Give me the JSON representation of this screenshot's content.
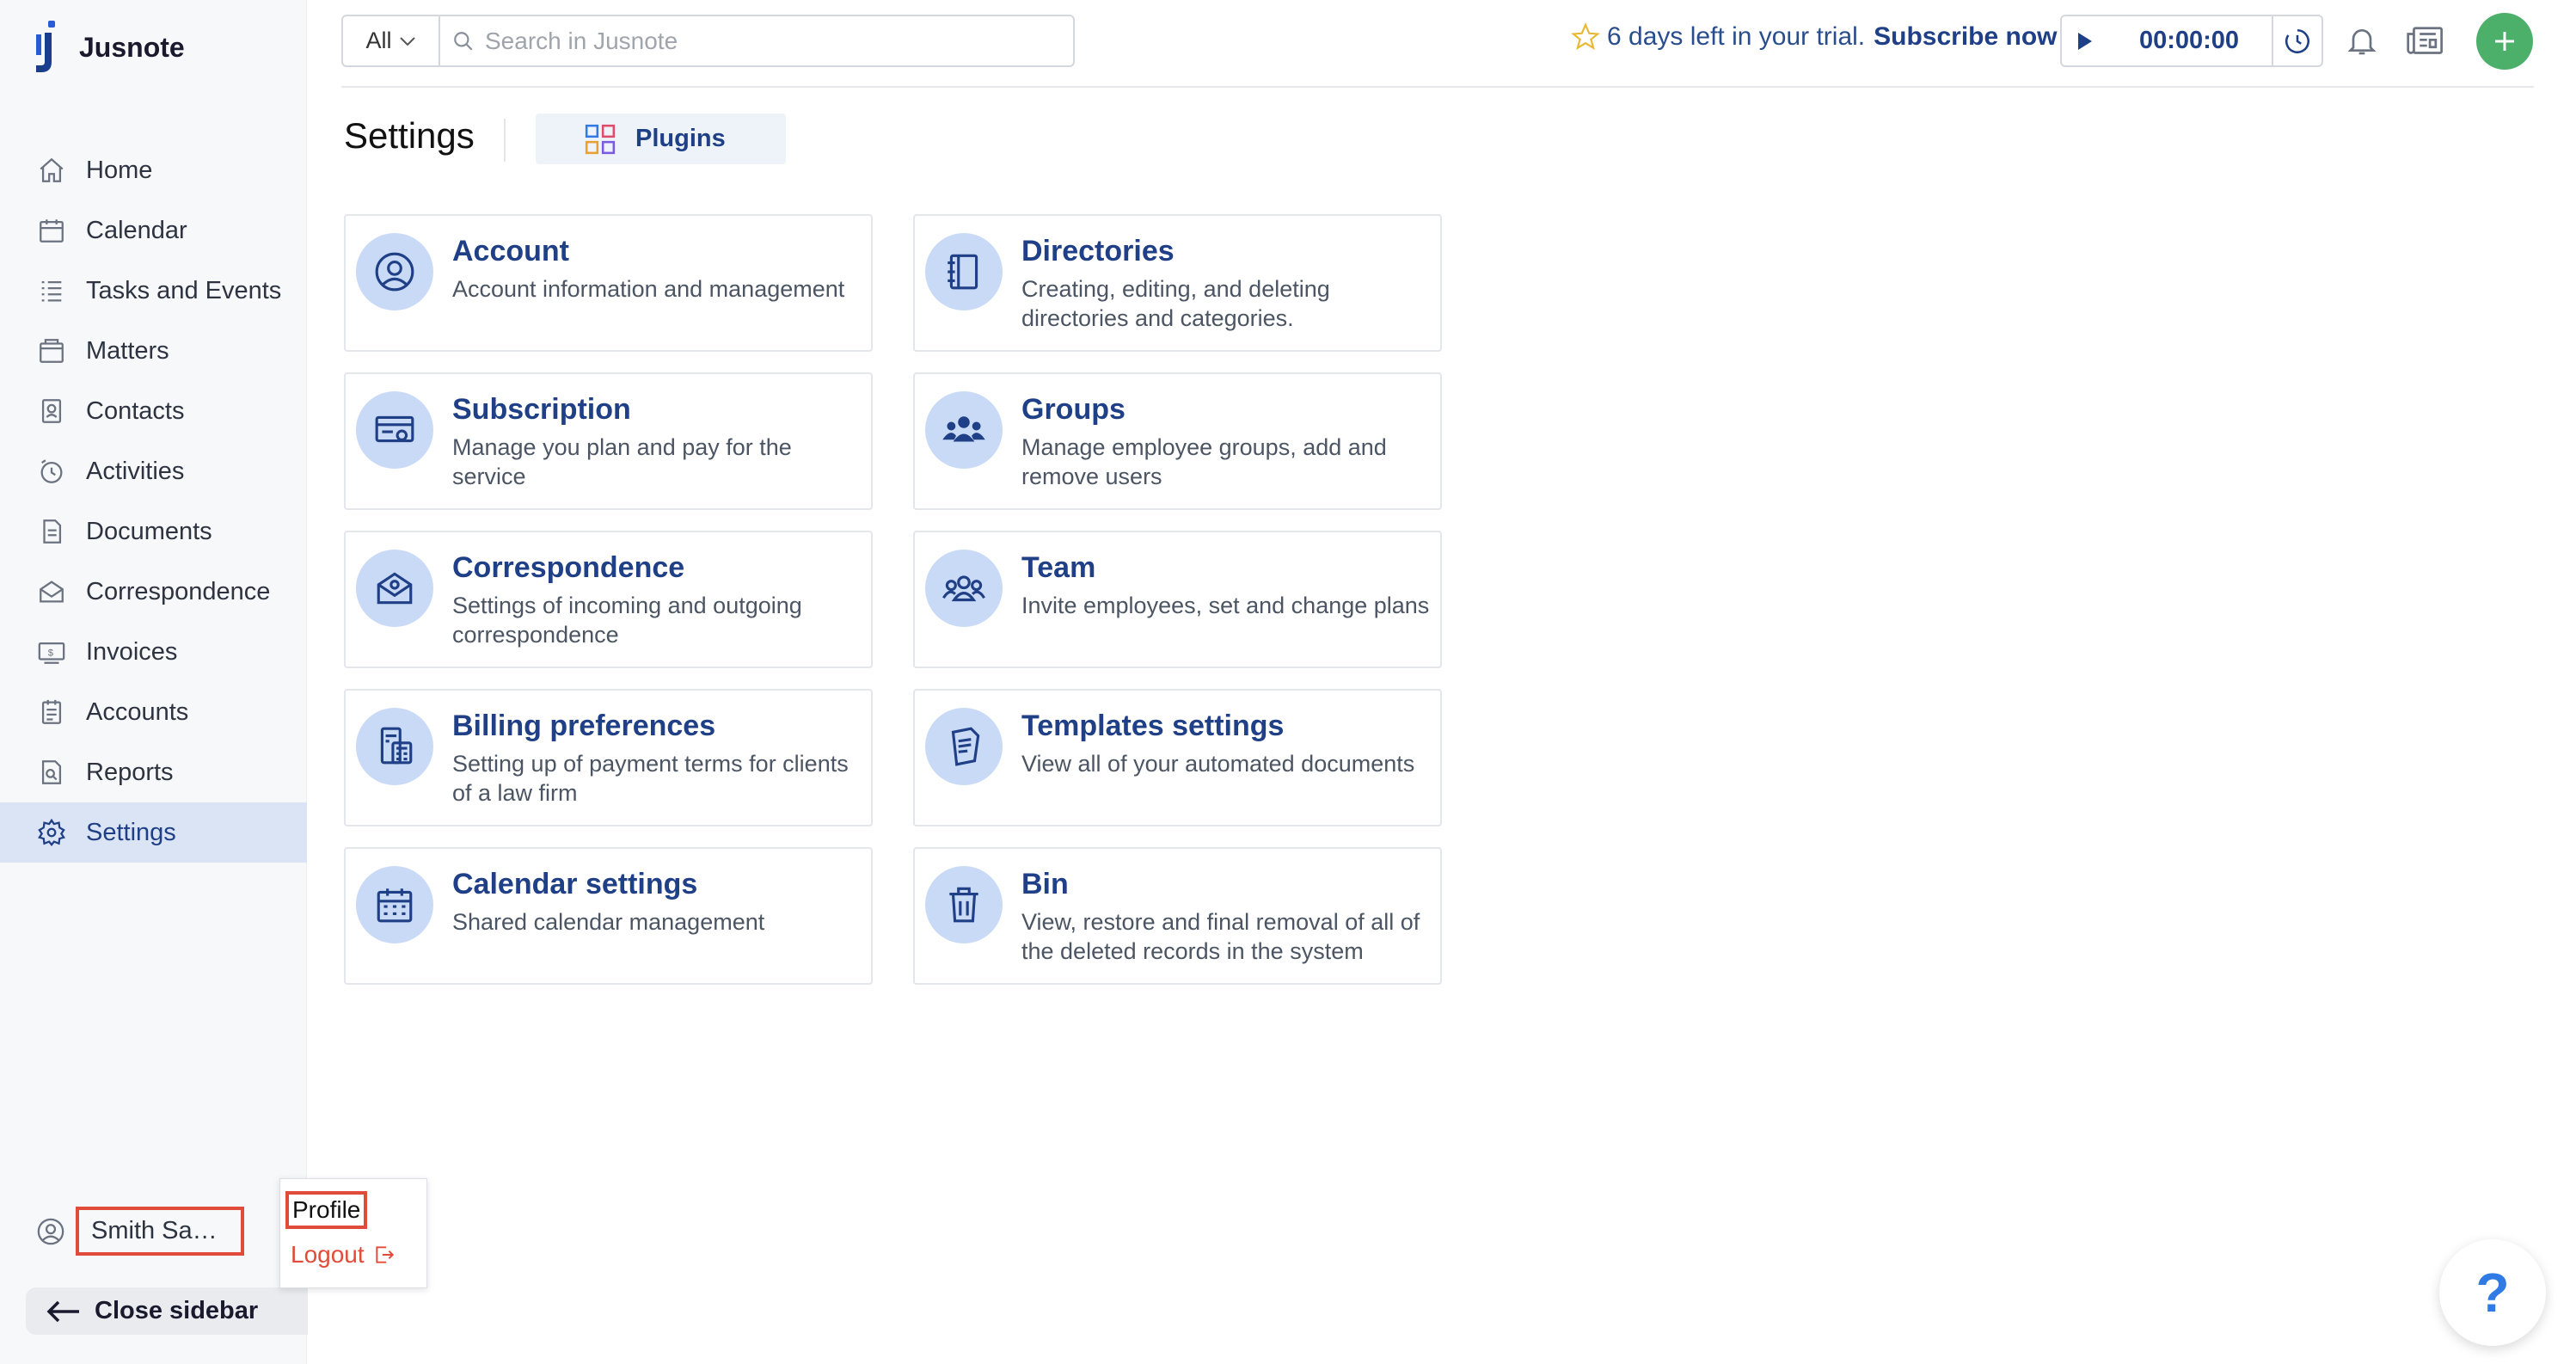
{
  "app": {
    "name": "Jusnote"
  },
  "sidebar": {
    "items": [
      {
        "label": "Home",
        "icon": "home-icon"
      },
      {
        "label": "Calendar",
        "icon": "calendar-icon"
      },
      {
        "label": "Tasks and Events",
        "icon": "tasks-icon"
      },
      {
        "label": "Matters",
        "icon": "matters-icon"
      },
      {
        "label": "Contacts",
        "icon": "contacts-icon"
      },
      {
        "label": "Activities",
        "icon": "activities-icon"
      },
      {
        "label": "Documents",
        "icon": "documents-icon"
      },
      {
        "label": "Correspondence",
        "icon": "correspondence-icon"
      },
      {
        "label": "Invoices",
        "icon": "invoices-icon"
      },
      {
        "label": "Accounts",
        "icon": "accounts-icon"
      },
      {
        "label": "Reports",
        "icon": "reports-icon"
      },
      {
        "label": "Settings",
        "icon": "settings-icon",
        "active": true
      }
    ],
    "user_name": "Smith Sam...",
    "close_label": "Close sidebar"
  },
  "user_menu": {
    "profile_label": "Profile",
    "logout_label": "Logout"
  },
  "topbar": {
    "search_filter": "All",
    "search_placeholder": "Search in Jusnote",
    "trial_text": "6 days left in your trial.",
    "subscribe_label": "Subscribe now",
    "timer": "00:00:00"
  },
  "page": {
    "title": "Settings",
    "plugins_label": "Plugins"
  },
  "cards": [
    {
      "title": "Account",
      "desc": "Account information and management",
      "icon": "account-icon"
    },
    {
      "title": "Directories",
      "desc": "Creating, editing, and deleting directories and categories.",
      "icon": "directories-icon"
    },
    {
      "title": "Subscription",
      "desc": "Manage you plan and pay for the service",
      "icon": "subscription-icon"
    },
    {
      "title": "Groups",
      "desc": "Manage employee groups, add and remove users",
      "icon": "groups-icon"
    },
    {
      "title": "Correspondence",
      "desc": "Settings of incoming and outgoing correspondence",
      "icon": "correspondence-icon"
    },
    {
      "title": "Team",
      "desc": "Invite employees, set and change plans",
      "icon": "team-icon"
    },
    {
      "title": "Billing preferences",
      "desc": "Setting up of payment terms for clients of a law firm",
      "icon": "billing-icon"
    },
    {
      "title": "Templates settings",
      "desc": "View all of your automated documents",
      "icon": "templates-icon"
    },
    {
      "title": "Calendar settings",
      "desc": "Shared calendar management",
      "icon": "calendar-settings-icon"
    },
    {
      "title": "Bin",
      "desc": "View, restore and final removal of all of the deleted records in the system",
      "icon": "bin-icon"
    }
  ],
  "help_label": "?",
  "colors": {
    "accent": "#1f3f86",
    "active_bg": "#dbe4f4",
    "icon_circle": "#c9daf6",
    "highlight": "#e14b3a",
    "add": "#4caf6a"
  }
}
